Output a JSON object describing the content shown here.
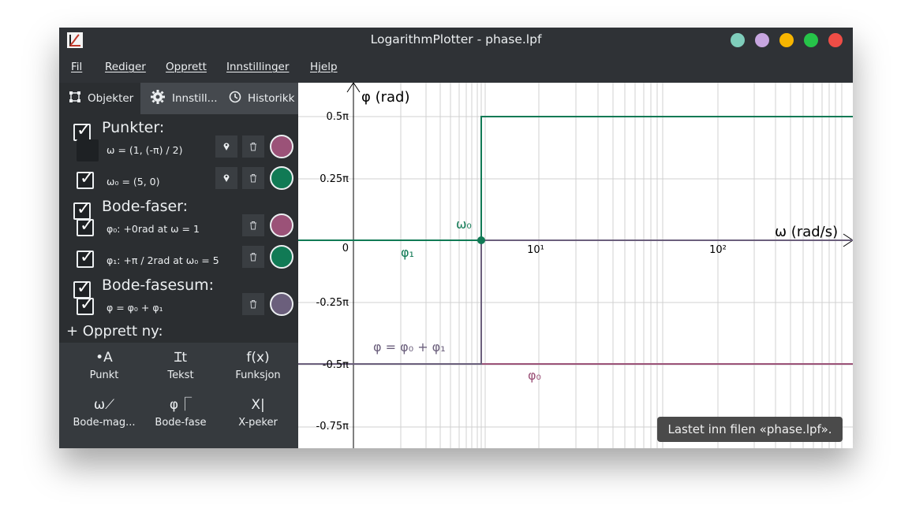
{
  "window": {
    "title": "LogarithmPlotter - phase.lpf",
    "buttons": [
      "#7fcdbb",
      "#c7a6e0",
      "#f7b500",
      "#26c449",
      "#ef4d46"
    ]
  },
  "menu": [
    "Fil",
    "Rediger",
    "Opprett",
    "Innstillinger",
    "Hjelp"
  ],
  "tabs": [
    {
      "icon": "objects-icon",
      "label": "Objekter"
    },
    {
      "icon": "gear-icon",
      "label": "Innstill..."
    },
    {
      "icon": "history-icon",
      "label": "Historikk"
    }
  ],
  "sections": {
    "points": {
      "title": "Punkter:"
    },
    "phases": {
      "title": "Bode-faser:"
    },
    "sum": {
      "title": "Bode-fasesum:"
    }
  },
  "objects": {
    "omega": {
      "label": "ω = (1, (-π) / 2)",
      "color": "#9b5278"
    },
    "omega0": {
      "label": "ω₀ = (5, 0)",
      "color": "#117a55"
    },
    "phi0": {
      "label": "φ₀: +0rad at ω = 1",
      "color": "#9b5278"
    },
    "phi1": {
      "label": "φ₁: +π / 2rad at ω₀ = 5",
      "color": "#117a55"
    },
    "phisum": {
      "label": "φ = φ₀ + φ₁",
      "color": "#6b5f7c"
    }
  },
  "create": {
    "title": "+ Opprett ny:",
    "items": [
      {
        "glyph": "•A",
        "label": "Punkt"
      },
      {
        "glyph": "Ɪt",
        "label": "Tekst"
      },
      {
        "glyph": "f(x)",
        "label": "Funksjon"
      },
      {
        "glyph": "ω⟋",
        "label": "Bode-mag..."
      },
      {
        "glyph": "φ⎾",
        "label": "Bode-fase"
      },
      {
        "glyph": "X|",
        "label": "X-peker"
      }
    ]
  },
  "plot": {
    "ylabel": "φ (rad)",
    "xlabel": "ω (rad/s)",
    "y_ticks": [
      "0.5π",
      "0.25π",
      "0",
      "-0.25π",
      "-0.5π",
      "-0.75π"
    ],
    "x_ticks": [
      "10¹",
      "10²"
    ],
    "labels": {
      "omega0": "ω₀",
      "phi1": "φ₁",
      "phisum": "φ = φ₀ + φ₁",
      "phi0": "φ₀"
    },
    "colors": {
      "phi1": "#117a55",
      "phi0": "#9b5278",
      "phisum": "#6b5f7c"
    }
  },
  "toast": "Lastet inn filen «phase.lpf»."
}
